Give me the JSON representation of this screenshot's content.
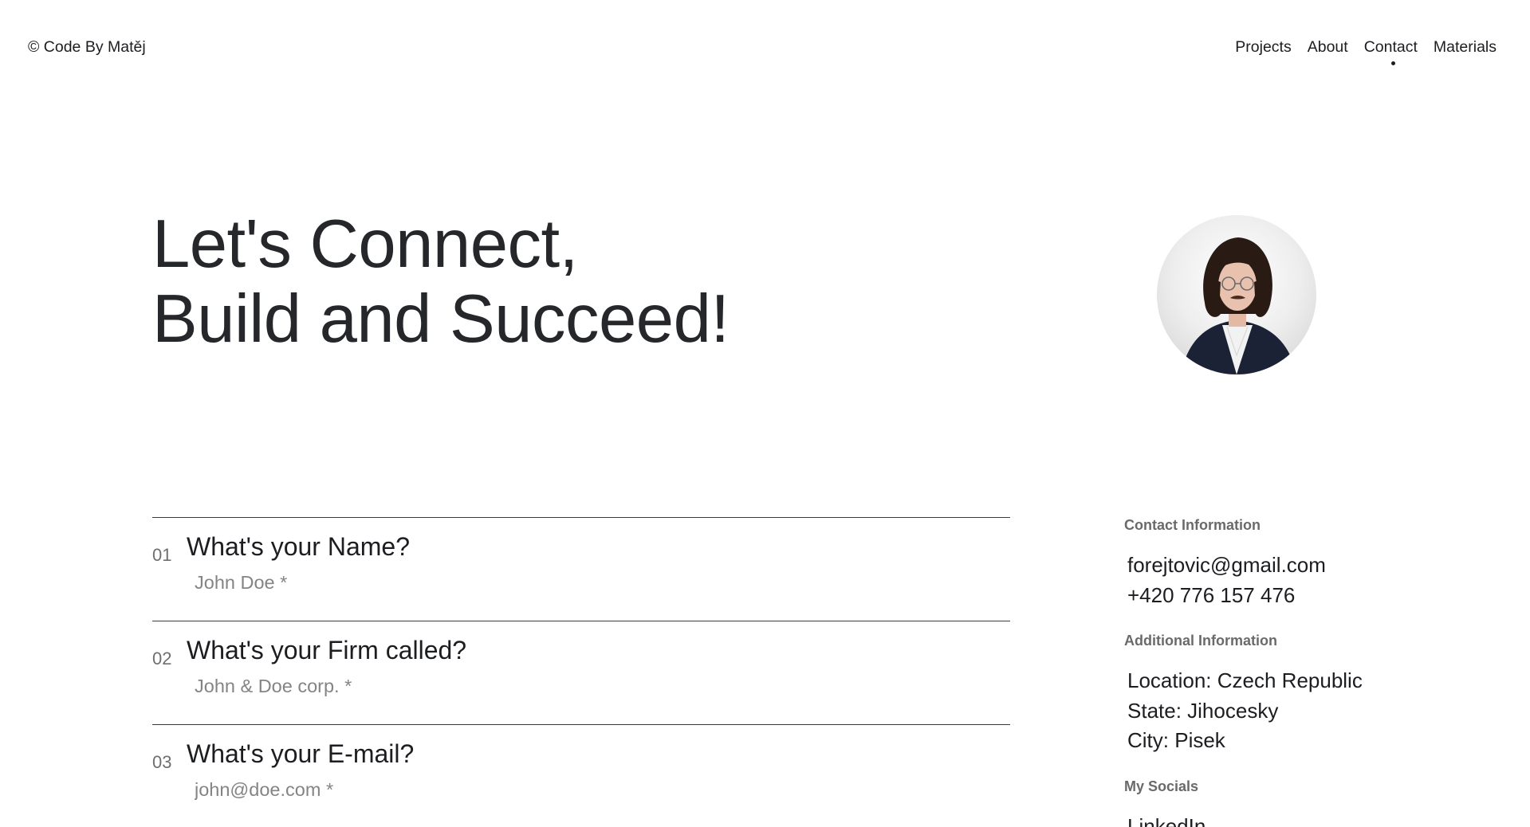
{
  "header": {
    "brand": "© Code By Matěj",
    "nav": [
      {
        "label": "Projects"
      },
      {
        "label": "About"
      },
      {
        "label": "Contact"
      },
      {
        "label": "Materials"
      }
    ]
  },
  "hero": {
    "line1": "Let's Connect,",
    "line2": "Build and Succeed!"
  },
  "form": {
    "fields": [
      {
        "number": "01",
        "label": "What's your Name?",
        "placeholder": "John Doe *"
      },
      {
        "number": "02",
        "label": "What's your Firm called?",
        "placeholder": "John & Doe corp. *"
      },
      {
        "number": "03",
        "label": "What's your E-mail?",
        "placeholder": "john@doe.com *"
      }
    ]
  },
  "sidebar": {
    "contact_heading": "Contact Information",
    "email": "forejtovic@gmail.com",
    "phone": "+420 776 157 476",
    "additional_heading": "Additional Information",
    "location": "Location: Czech Republic",
    "state": "State: Jihocesky",
    "city": "City: Pisek",
    "socials_heading": "My Socials",
    "socials": [
      "LinkedIn"
    ]
  }
}
